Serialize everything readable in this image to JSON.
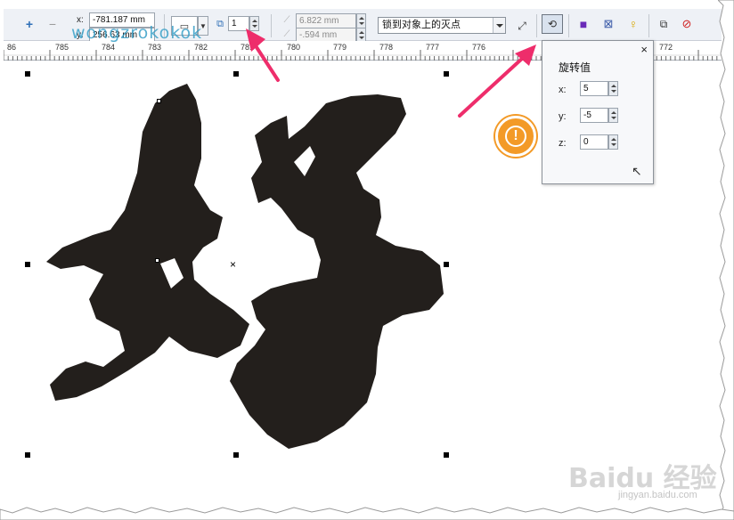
{
  "toolbar": {
    "x_label": "x:",
    "x_value": "-781.187 mm",
    "y_label": "y:",
    "y_value": "256.63 mm",
    "copies_value": "1",
    "offset_x_value": "6.822 mm",
    "offset_y_value": "-.594 mm",
    "vanish_point_option": "锁到对象上的灭点"
  },
  "ruler": {
    "ticks": [
      "86",
      "785",
      "784",
      "783",
      "782",
      "781",
      "780",
      "779",
      "778",
      "777",
      "776",
      "772"
    ]
  },
  "rotation_popup": {
    "title": "旋转值",
    "close": "×",
    "x_label": "x:",
    "x_value": "5",
    "y_label": "y:",
    "y_value": "-5",
    "z_label": "z:",
    "z_value": "0"
  },
  "annotation": {
    "badge_glyph": "!"
  },
  "watermark": {
    "text": "wongzrokokok",
    "baidu": "Baidu 经验",
    "baidu_sub": "jingyan.baidu.com"
  },
  "colors": {
    "glyph_fill": "#231f1c",
    "arrow_color": "#ee2d6b",
    "badge_color": "#f39a27",
    "toolbar_bg": "#eef1f6"
  }
}
